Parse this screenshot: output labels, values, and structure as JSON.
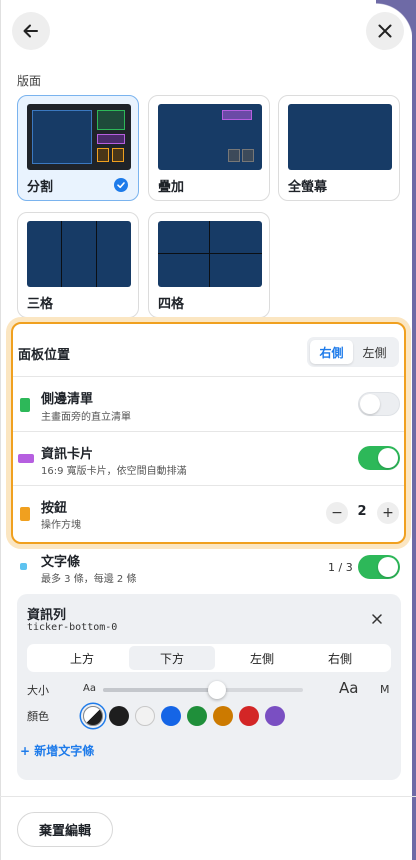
{
  "colors": {
    "accent": "#1e7bea",
    "toggle_on": "#2db859",
    "highlight": "#f0a01f",
    "thumb_bg": "#173b66"
  },
  "header": {
    "back_icon": "arrow-left-icon",
    "close_icon": "close-icon"
  },
  "layout_section": {
    "label": "版面"
  },
  "layouts": [
    {
      "label": "分割",
      "selected": true
    },
    {
      "label": "疊加",
      "selected": false
    },
    {
      "label": "全螢幕",
      "selected": false
    },
    {
      "label": "三格",
      "selected": false
    },
    {
      "label": "四格",
      "selected": false
    }
  ],
  "panel": {
    "title": "面板位置",
    "position_options": [
      "右側",
      "左側"
    ],
    "position_selected": "右側",
    "rows": [
      {
        "title": "側邊清單",
        "subtitle": "主畫面旁的直立清單",
        "color": "#2db859",
        "control": "toggle",
        "on": false
      },
      {
        "title": "資訊卡片",
        "subtitle": "16:9 寬版卡片，依空間自動排滿",
        "color": "#b65fe0",
        "control": "toggle",
        "on": true
      },
      {
        "title": "按鈕",
        "subtitle": "操作方塊",
        "color": "#f0a01f",
        "control": "stepper",
        "value": "2",
        "minus": "−",
        "plus": "+"
      }
    ]
  },
  "ticker": {
    "title": "文字條",
    "subtitle": "最多 3 條，每邊 2 條",
    "count": "1 / 3",
    "color": "#5ec3f0",
    "on": true
  },
  "ticker_item": {
    "title": "資訊列",
    "id": "ticker-bottom-0",
    "positions": [
      "上方",
      "下方",
      "左側",
      "右側"
    ],
    "position_selected": "下方",
    "size_label": "大小",
    "size_small": "Aa",
    "size_large": "Aa",
    "size_value_label": "M",
    "size_fraction": 0.57,
    "color_label": "顏色",
    "colors": [
      "auto",
      "#1e1e1e",
      "#f2f2f2",
      "#1565e6",
      "#1f8f3a",
      "#cc7a00",
      "#d32626",
      "#7a4fc2"
    ],
    "selected_color": "auto"
  },
  "add_ticker": {
    "label": "+ 新增文字條"
  },
  "footer": {
    "discard_label": "棄置編輯"
  }
}
